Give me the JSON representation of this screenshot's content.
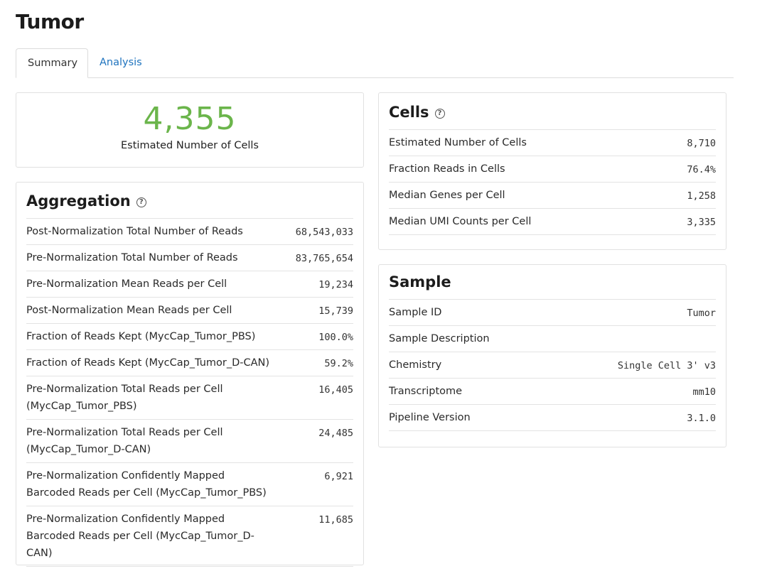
{
  "page": {
    "title": "Tumor"
  },
  "tabs": [
    {
      "label": "Summary",
      "active": true
    },
    {
      "label": "Analysis",
      "active": false
    }
  ],
  "hero": {
    "value": "4,355",
    "label": "Estimated Number of Cells",
    "color": "#6bb54b"
  },
  "aggregation": {
    "title": "Aggregation",
    "help_icon": "question-circle-icon",
    "rows": [
      {
        "label": "Post-Normalization Total Number of Reads",
        "value": "68,543,033"
      },
      {
        "label": "Pre-Normalization Total Number of Reads",
        "value": "83,765,654"
      },
      {
        "label": "Pre-Normalization Mean Reads per Cell",
        "value": "19,234"
      },
      {
        "label": "Post-Normalization Mean Reads per Cell",
        "value": "15,739"
      },
      {
        "label": "Fraction of Reads Kept (MycCap_Tumor_PBS)",
        "value": "100.0%"
      },
      {
        "label": "Fraction of Reads Kept (MycCap_Tumor_D-CAN)",
        "value": "59.2%"
      },
      {
        "label": "Pre-Normalization Total Reads per Cell (MycCap_Tumor_PBS)",
        "value": "16,405"
      },
      {
        "label": "Pre-Normalization Total Reads per Cell (MycCap_Tumor_D-CAN)",
        "value": "24,485"
      },
      {
        "label": "Pre-Normalization Confidently Mapped Barcoded Reads per Cell (MycCap_Tumor_PBS)",
        "value": "6,921"
      },
      {
        "label": "Pre-Normalization Confidently Mapped Barcoded Reads per Cell (MycCap_Tumor_D-CAN)",
        "value": "11,685"
      }
    ]
  },
  "cells": {
    "title": "Cells",
    "help_icon": "question-circle-icon",
    "rows": [
      {
        "label": "Estimated Number of Cells",
        "value": "8,710"
      },
      {
        "label": "Fraction Reads in Cells",
        "value": "76.4%"
      },
      {
        "label": "Median Genes per Cell",
        "value": "1,258"
      },
      {
        "label": "Median UMI Counts per Cell",
        "value": "3,335"
      }
    ]
  },
  "sample": {
    "title": "Sample",
    "rows": [
      {
        "label": "Sample ID",
        "value": "Tumor"
      },
      {
        "label": "Sample Description",
        "value": ""
      },
      {
        "label": "Chemistry",
        "value": "Single Cell 3' v3"
      },
      {
        "label": "Transcriptome",
        "value": "mm10"
      },
      {
        "label": "Pipeline Version",
        "value": "3.1.0"
      }
    ]
  }
}
